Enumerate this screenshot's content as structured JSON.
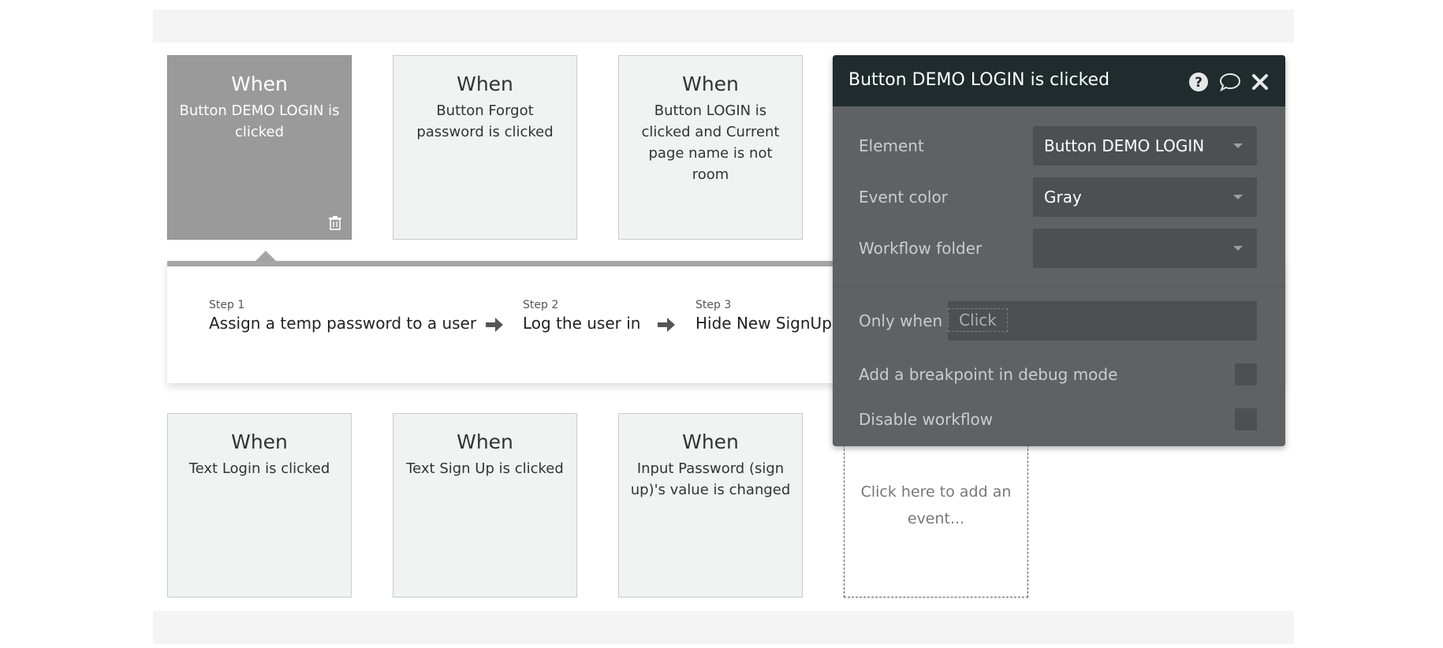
{
  "cards_top": [
    {
      "when": "When",
      "desc": "Button DEMO LOGIN is clicked"
    },
    {
      "when": "When",
      "desc": "Button Forgot password is clicked"
    },
    {
      "when": "When",
      "desc": "Button LOGIN is clicked and Current page name is not room"
    }
  ],
  "cards_bottom": [
    {
      "when": "When",
      "desc": "Text Login is clicked"
    },
    {
      "when": "When",
      "desc": "Text Sign Up is clicked"
    },
    {
      "when": "When",
      "desc": "Input Password (sign up)'s value is changed"
    }
  ],
  "add_event": "Click here to add an event...",
  "steps": [
    {
      "num": "Step 1",
      "label": "Assign a temp password to a user"
    },
    {
      "num": "Step 2",
      "label": "Log the user in"
    },
    {
      "num": "Step 3",
      "label": "Hide New SignUp"
    }
  ],
  "popup": {
    "title": "Button DEMO LOGIN is clicked",
    "element_label": "Element",
    "element_value": "Button DEMO LOGIN",
    "event_color_label": "Event color",
    "event_color_value": "Gray",
    "workflow_folder_label": "Workflow folder",
    "workflow_folder_value": "",
    "only_when_label": "Only when",
    "only_when_placeholder": "Click",
    "breakpoint_label": "Add a breakpoint in debug mode",
    "disable_label": "Disable workflow"
  },
  "icons": {
    "help": "help-icon",
    "comment": "comment-icon",
    "close": "close-icon",
    "trash": "trash-icon",
    "arrow": "arrow-right-icon"
  },
  "colors": {
    "popup_bg": "#5e6264",
    "popup_header": "#1f2b2c",
    "selected_card": "#9a9a9a",
    "card_bg": "#f1f2f2"
  }
}
